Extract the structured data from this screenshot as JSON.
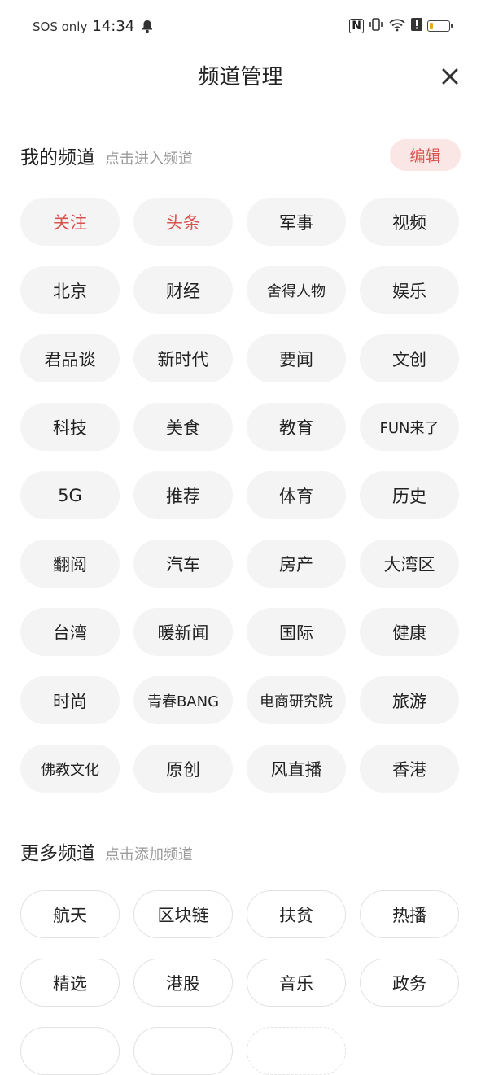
{
  "status_bar": {
    "network_text": "SOS only",
    "time": "14:34",
    "icons": [
      "bell-icon",
      "nfc-icon",
      "vibrate-icon",
      "wifi-icon",
      "alert-icon",
      "battery-icon"
    ],
    "nfc_label": "N",
    "battery_level": 0.2,
    "battery_color": "#f0a422"
  },
  "header": {
    "title": "频道管理",
    "close_icon": "close-icon"
  },
  "my_channels": {
    "title": "我的频道",
    "hint": "点击进入频道",
    "edit_label": "编辑",
    "items": [
      "关注",
      "头条",
      "军事",
      "视频",
      "北京",
      "财经",
      "舍得人物",
      "娱乐",
      "君品谈",
      "新时代",
      "要闻",
      "文创",
      "科技",
      "美食",
      "教育",
      "FUN来了",
      "5G",
      "推荐",
      "体育",
      "历史",
      "翻阅",
      "汽车",
      "房产",
      "大湾区",
      "台湾",
      "暖新闻",
      "国际",
      "健康",
      "时尚",
      "青春BANG",
      "电商研究院",
      "旅游",
      "佛教文化",
      "原创",
      "风直播",
      "香港"
    ]
  },
  "more_channels": {
    "title": "更多频道",
    "hint": "点击添加频道",
    "items": [
      "航天",
      "区块链",
      "扶贫",
      "热播",
      "精选",
      "港股",
      "音乐",
      "政务"
    ]
  },
  "colors": {
    "accent": "#d9534f",
    "edit_bg": "#fbe6e6",
    "chip_bg": "#f4f4f4",
    "hint": "#9a9a9a"
  }
}
